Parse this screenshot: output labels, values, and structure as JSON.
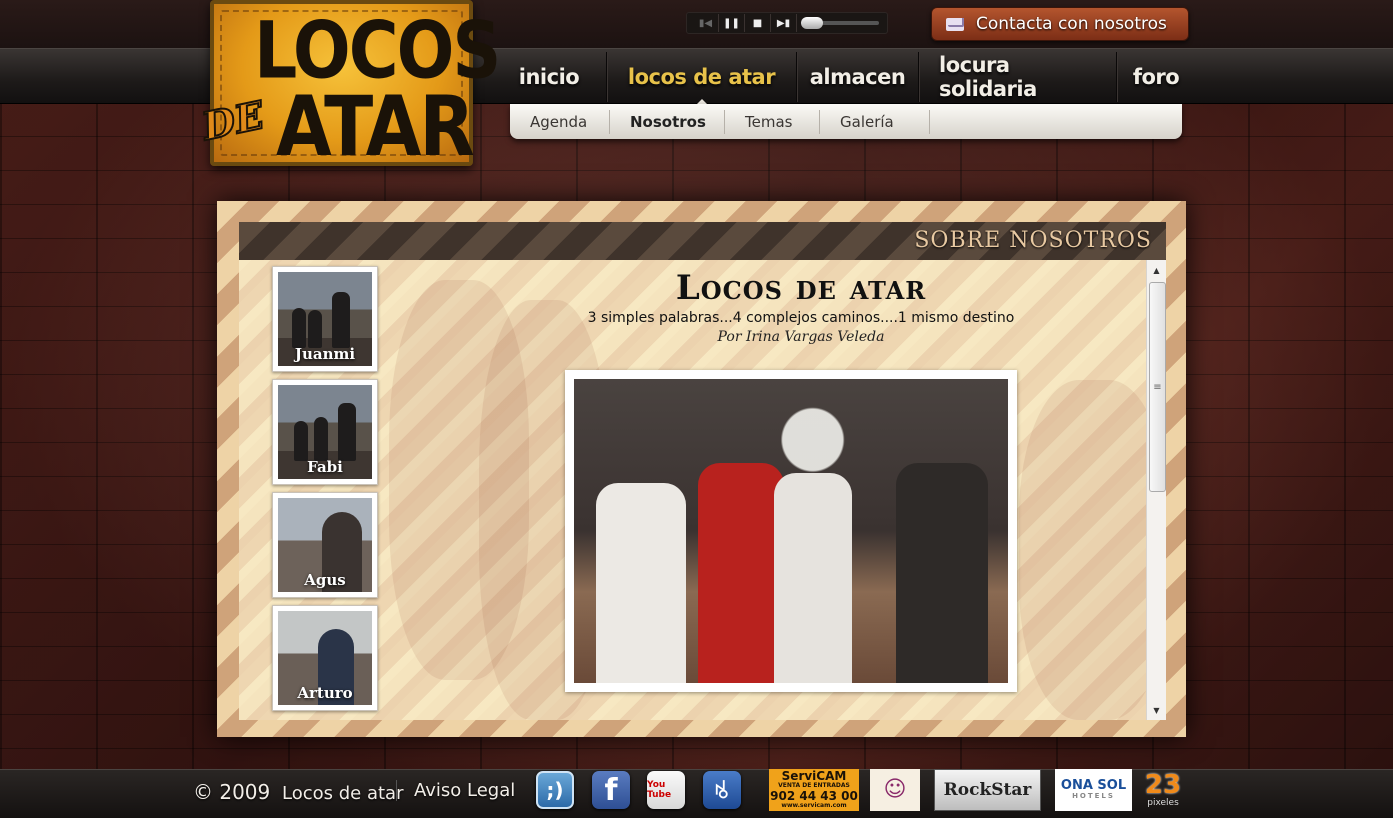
{
  "brand": {
    "logo_line1": "LOCOS",
    "logo_line2a": "DE",
    "logo_line2b": "ATAR"
  },
  "player": {
    "buttons": [
      "prev-icon",
      "pause-icon",
      "stop-icon",
      "next-icon"
    ],
    "volume_level": 0.2
  },
  "contact": {
    "label": "Contacta con nosotros"
  },
  "main_nav": {
    "items": [
      {
        "label": "inicio"
      },
      {
        "label": "locos de atar",
        "active": true
      },
      {
        "label": "almacen"
      },
      {
        "label": "locura solidaria"
      },
      {
        "label": "foro"
      }
    ]
  },
  "sub_nav": {
    "items": [
      {
        "label": "Agenda"
      },
      {
        "label": "Nosotros",
        "active": true
      },
      {
        "label": "Temas"
      },
      {
        "label": "Galería"
      }
    ]
  },
  "panel": {
    "heading": "SOBRE NOSOTROS",
    "members": [
      {
        "name": "Juanmi"
      },
      {
        "name": "Fabi"
      },
      {
        "name": "Agus"
      },
      {
        "name": "Arturo"
      }
    ],
    "article": {
      "title": "Locos de atar",
      "lead": "3 simples palabras...4 complejos caminos....1 mismo destino",
      "byline": "Por Irina Vargas Veleda"
    }
  },
  "footer": {
    "copyright": "© 2009",
    "copyright_name": "Locos de atar",
    "legal": "Aviso Legal",
    "social": [
      {
        "icon": "tuenti-icon",
        "glyph": ";)"
      },
      {
        "icon": "facebook-icon",
        "glyph": "f"
      },
      {
        "icon": "youtube-icon",
        "glyph": "You Tube"
      },
      {
        "icon": "myspace-icon",
        "glyph": "ꂚ"
      }
    ],
    "sponsors": [
      {
        "name": "ServiCAM",
        "line2": "VENTA DE ENTRADAS",
        "line3": "902 44 43 00",
        "line4": "www.servicam.com"
      },
      {
        "name": "mask-logo"
      },
      {
        "name": "RockStar"
      },
      {
        "name": "ONA SOL",
        "line2": "HOTELS"
      },
      {
        "name": "23",
        "line2": "pixeles"
      }
    ]
  },
  "colors": {
    "accent_gold": "#e8c24a",
    "contact_button": "#a34823",
    "panel_heading": "#e8c9a2"
  }
}
